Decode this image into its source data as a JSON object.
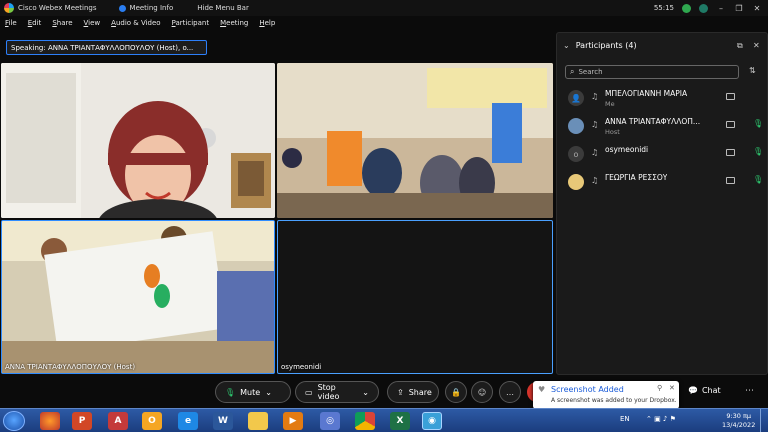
{
  "titlebar": {
    "app_title": "Cisco Webex Meetings",
    "meeting_info": "Meeting Info",
    "hide_menu": "Hide Menu Bar",
    "timer": "55:15"
  },
  "menu": [
    "File",
    "Edit",
    "Share",
    "View",
    "Audio & Video",
    "Participant",
    "Meeting",
    "Help"
  ],
  "speaking": "Speaking: ΑΝΝΑ ΤΡΙΑΝΤΑΦΥΛΛΟΠΟΥΛΟΥ (Host), o...",
  "tiles": {
    "t3_name": "ΑΝΝΑ ΤΡΙΑΝΤΑΦΥΛΛΟΠΟΥΛΟΥ (Host)",
    "t4_name": "osymeonidi"
  },
  "participants": {
    "title": "Participants (4)",
    "search_placeholder": "Search",
    "list": [
      {
        "name": "ΜΠΕΛΟΓΙΑΝΝΗ ΜΑΡΙΑ",
        "role": "Me"
      },
      {
        "name": "ΑΝΝΑ ΤΡΙΑΝΤΑΦΥΛΛΟΠ...",
        "role": "Host"
      },
      {
        "name": "osymeonidi",
        "role": ""
      },
      {
        "name": "ΓΕΩΡΓΙΑ ΡΕΣΣΟΥ",
        "role": ""
      }
    ]
  },
  "controls": {
    "mute": "Mute",
    "stop_video": "Stop video",
    "share": "Share",
    "chat": "Chat"
  },
  "toast": {
    "title": "Screenshot Added",
    "body": "A screenshot was added to your Dropbox."
  },
  "taskbar": {
    "lang": "EN",
    "time": "9:30 πμ",
    "date": "13/4/2022"
  },
  "colors": {
    "accent": "#2d7ff9",
    "mic_on": "#2ecc71",
    "end_red": "#d9352c"
  }
}
